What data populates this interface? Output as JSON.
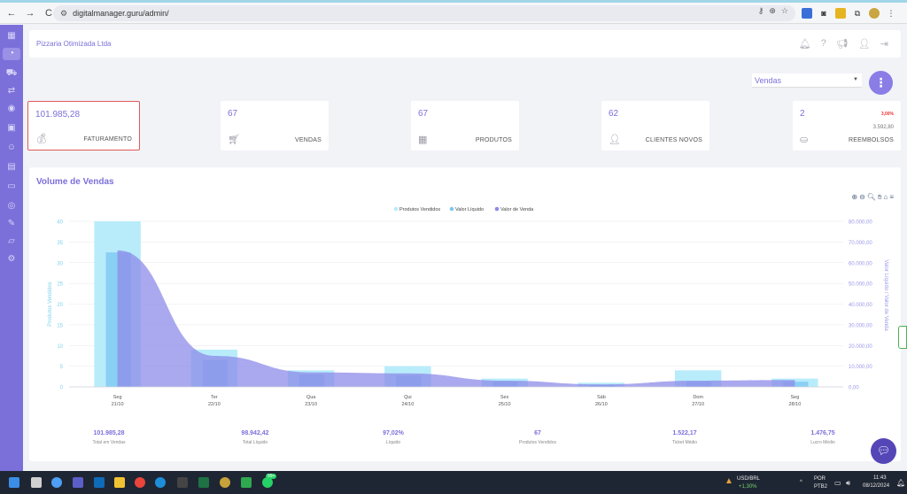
{
  "browser": {
    "url": "digitalmanager.guru/admin/",
    "back": "←",
    "forward": "→",
    "reload": "C"
  },
  "header": {
    "company": "Pizzaria Otimizada Ltda"
  },
  "select": {
    "value": "Vendas"
  },
  "fab_label": "⋮",
  "stats": [
    {
      "value": "101.985,28",
      "label": "FATURAMENTO",
      "icon": "money-bag-icon"
    },
    {
      "value": "67",
      "label": "VENDAS",
      "icon": "cart-icon"
    },
    {
      "value": "67",
      "label": "PRODUTOS",
      "icon": "boxes-icon"
    },
    {
      "value": "62",
      "label": "CLIENTES NOVOS",
      "icon": "user-plus-icon"
    },
    {
      "value": "2",
      "label": "REEMBOLSOS",
      "icon": "refund-icon",
      "percent": "3,00%",
      "sub": "3.592,80"
    }
  ],
  "chart_title": "Volume de Vendas",
  "chart_data": {
    "type": "bar",
    "categories": [
      "Seg 21/10",
      "Ter 22/10",
      "Qua 23/10",
      "Qui 24/10",
      "Sex 25/10",
      "Sáb 26/10",
      "Dom 27/10",
      "Seg 28/10"
    ],
    "category_lines": [
      [
        "Seg",
        "21/10"
      ],
      [
        "Ter",
        "22/10"
      ],
      [
        "Qua",
        "23/10"
      ],
      [
        "Qui",
        "24/10"
      ],
      [
        "Sex",
        "25/10"
      ],
      [
        "Sáb",
        "26/10"
      ],
      [
        "Dom",
        "27/10"
      ],
      [
        "Seg",
        "28/10"
      ]
    ],
    "series": [
      {
        "name": "Produtos Vendidos",
        "axis": "left",
        "kind": "bar",
        "color": "#b8ecfb",
        "values": [
          40,
          9,
          4,
          5,
          2,
          1,
          4,
          2
        ]
      },
      {
        "name": "Valor Líquido",
        "axis": "right",
        "kind": "bar",
        "color": "#7ec8f2",
        "values": [
          65000,
          13000,
          6000,
          5500,
          2500,
          1000,
          2500,
          2500
        ]
      },
      {
        "name": "Valor de Venda",
        "axis": "right",
        "kind": "area",
        "color": "#8e8be8",
        "values": [
          66000,
          15000,
          7000,
          6500,
          3000,
          1200,
          3000,
          3300
        ]
      }
    ],
    "ylabel": "Produtos Vendidos",
    "y2label": "Valor Líquido / Valor de Venda",
    "ylim": [
      0,
      40
    ],
    "y2lim": [
      0,
      80000
    ],
    "yticks": [
      "0",
      "5",
      "10",
      "15",
      "20",
      "25",
      "30",
      "35",
      "40"
    ],
    "y2ticks": [
      "0,00",
      "10.000,00",
      "20.000,00",
      "30.000,00",
      "40.000,00",
      "50.000,00",
      "60.000,00",
      "70.000,00",
      "80.000,00"
    ],
    "legend_position": "top-center"
  },
  "summary": [
    {
      "value": "101.985,28",
      "label": "Total em Vendas"
    },
    {
      "value": "98.942,42",
      "label": "Total Líquido"
    },
    {
      "value": "97,02%",
      "label": "Líquido"
    },
    {
      "value": "67",
      "label": "Produtos Vendidos"
    },
    {
      "value": "1.522,17",
      "label": "Ticket Médio"
    },
    {
      "value": "1.476,75",
      "label": "Lucro Médio"
    }
  ],
  "taskbar": {
    "ticker": "USD/BRL",
    "ticker_change": "+1,30%",
    "lang": "POR",
    "lang2": "PTB2",
    "time": "11:43",
    "date": "08/12/2024",
    "badge": "99+"
  }
}
